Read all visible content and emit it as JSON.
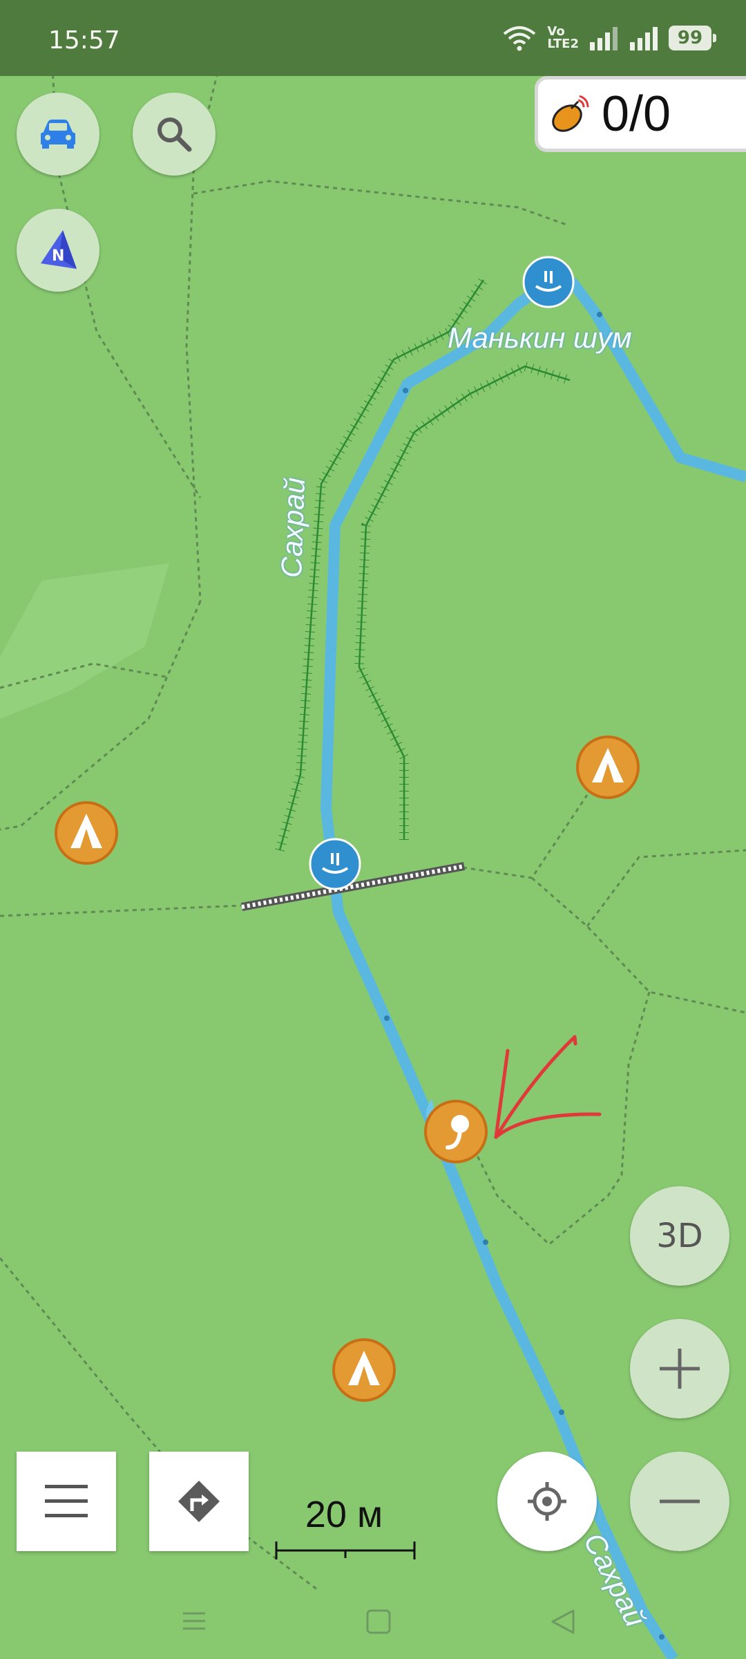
{
  "status_bar": {
    "time": "15:57",
    "network_label_top": "Vo",
    "network_label_bottom": "LTE2",
    "battery": "99"
  },
  "controls": {
    "car_button_icon": "car-icon",
    "search_button_icon": "search-icon",
    "compass_label": "N",
    "gps_count": "0/0",
    "button_3d_label": "3D",
    "zoom_in_icon": "plus-icon",
    "zoom_out_icon": "minus-icon",
    "menu_icon": "hamburger-icon",
    "route_icon": "route-turn-icon",
    "locate_icon": "crosshair-icon"
  },
  "map": {
    "labels": {
      "waterfall_name": "Манькин шум",
      "river_upper": "Сахрай",
      "river_lower": "Сахрай"
    },
    "scale_label": "20 м",
    "markers": [
      {
        "type": "waterfall",
        "icon": "waterfall-icon"
      },
      {
        "type": "waterfall",
        "icon": "waterfall-icon"
      },
      {
        "type": "camping",
        "icon": "tent-icon"
      },
      {
        "type": "camping",
        "icon": "tent-icon"
      },
      {
        "type": "camping",
        "icon": "tent-icon"
      },
      {
        "type": "spring",
        "icon": "spring-icon"
      }
    ]
  },
  "colors": {
    "map_background": "#88c970",
    "river": "#5ab8e0",
    "status_bar": "#4f7b3f",
    "poi_orange": "#e39a33",
    "annotation_arrow": "#e0393a"
  },
  "nav_bar": {
    "items": [
      "recent-apps-icon",
      "home-icon",
      "back-icon"
    ]
  }
}
